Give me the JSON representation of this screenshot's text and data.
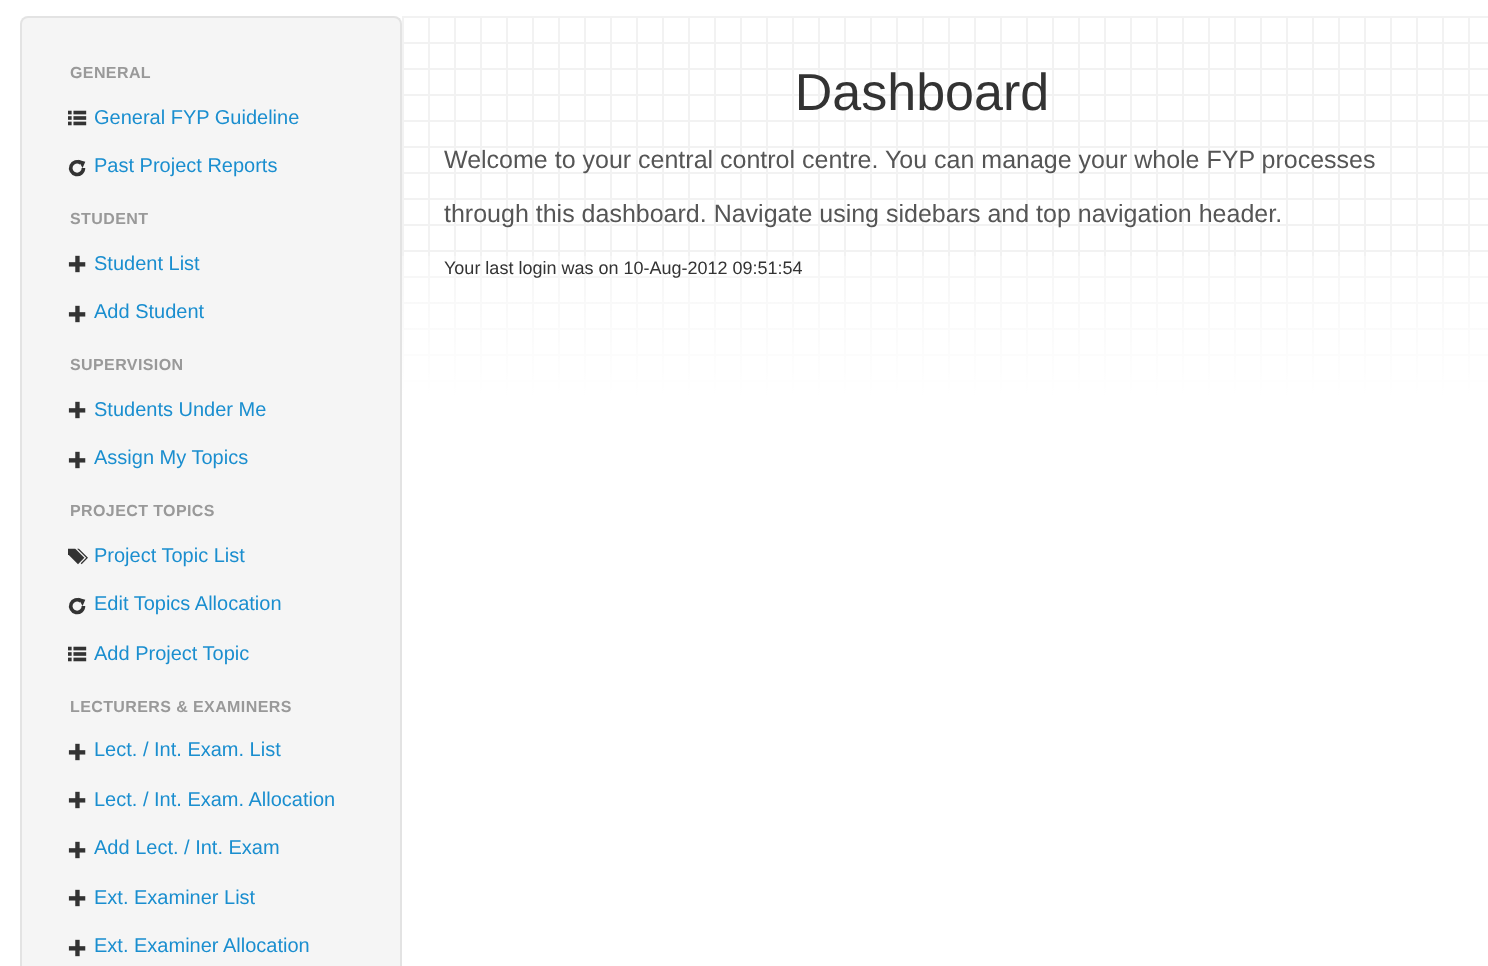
{
  "sidebar": {
    "sections": [
      {
        "header": "GENERAL",
        "items": [
          {
            "kind": "list",
            "label": "General FYP Guideline"
          },
          {
            "kind": "refresh",
            "label": "Past Project Reports"
          }
        ]
      },
      {
        "header": "STUDENT",
        "items": [
          {
            "kind": "plus",
            "label": "Student List"
          },
          {
            "kind": "plus",
            "label": "Add Student"
          }
        ]
      },
      {
        "header": "SUPERVISION",
        "items": [
          {
            "kind": "plus",
            "label": "Students Under Me"
          },
          {
            "kind": "plus",
            "label": "Assign My Topics"
          }
        ]
      },
      {
        "header": "PROJECT TOPICS",
        "items": [
          {
            "kind": "tags",
            "label": "Project Topic List"
          },
          {
            "kind": "refresh",
            "label": "Edit Topics Allocation"
          },
          {
            "kind": "list",
            "label": "Add Project Topic"
          }
        ]
      },
      {
        "header": "LECTURERS & EXAMINERS",
        "items": [
          {
            "kind": "plus",
            "label": "Lect. / Int. Exam. List"
          },
          {
            "kind": "plus",
            "label": "Lect. / Int. Exam. Allocation"
          },
          {
            "kind": "plus",
            "label": "Add Lect. / Int. Exam"
          },
          {
            "kind": "plus",
            "label": "Ext. Examiner List"
          },
          {
            "kind": "plus",
            "label": "Ext. Examiner Allocation"
          }
        ]
      }
    ]
  },
  "main": {
    "title": "Dashboard",
    "intro": "Welcome to your central control centre. You can manage your whole FYP processes through this dashboard. Navigate using sidebars and top navigation header.",
    "last_login": "Your last login was on 10-Aug-2012 09:51:54"
  }
}
